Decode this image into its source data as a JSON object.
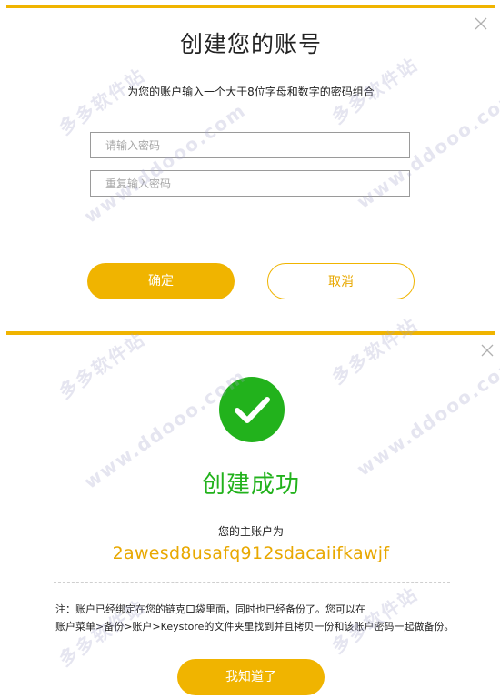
{
  "dialog_top": {
    "title": "创建您的账号",
    "hint": "为您的账户输入一个大于8位字母和数字的密码组合",
    "password_placeholder": "请输入密码",
    "confirm_placeholder": "重复输入密码",
    "ok_label": "确定",
    "cancel_label": "取消"
  },
  "dialog_bottom": {
    "success_title": "创建成功",
    "account_label": "您的主账户为",
    "account_value": "2awesd8usafq912sdacaiifkawjf",
    "note_line1": "注：账户已经绑定在您的链克口袋里面，同时也已经备份了。您可以在",
    "note_line2": "账户菜单>备份>账户>Keystore的文件夹里找到并且拷贝一份和该账户密码一起做备份。",
    "confirm_label": "我知道了"
  },
  "watermark": {
    "site_cn": "多多软件站",
    "site_url": "www.ddooo.com"
  },
  "colors": {
    "accent": "#f0b400",
    "success": "#22b21c",
    "account_text": "#e8a800"
  },
  "icons": {
    "close": "close-icon",
    "success": "checkmark-circle-icon"
  }
}
